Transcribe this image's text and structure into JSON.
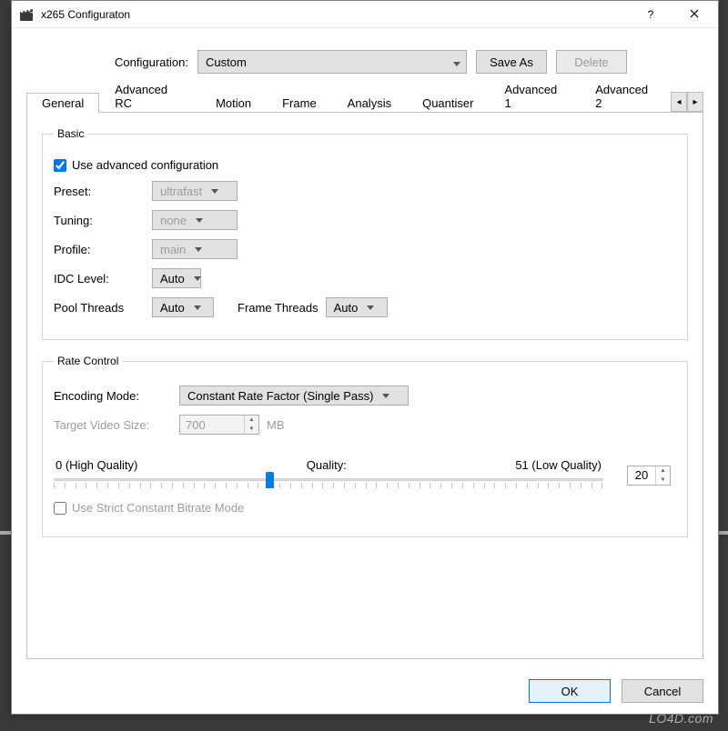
{
  "dialog": {
    "title": "x265 Configuraton"
  },
  "top": {
    "label": "Configuration:",
    "value": "Custom",
    "save_as": "Save As",
    "delete": "Delete"
  },
  "tabs": {
    "items": [
      {
        "label": "General",
        "active": true
      },
      {
        "label": "Advanced RC"
      },
      {
        "label": "Motion"
      },
      {
        "label": "Frame"
      },
      {
        "label": "Analysis"
      },
      {
        "label": "Quantiser"
      },
      {
        "label": "Advanced 1"
      },
      {
        "label": "Advanced 2"
      }
    ],
    "scroll_left": "◂",
    "scroll_right": "▸"
  },
  "basic": {
    "legend": "Basic",
    "use_advanced": {
      "label": "Use advanced configuration",
      "checked": true
    },
    "preset": {
      "label": "Preset:",
      "value": "ultrafast",
      "disabled": true
    },
    "tuning": {
      "label": "Tuning:",
      "value": "none",
      "disabled": true
    },
    "profile": {
      "label": "Profile:",
      "value": "main",
      "disabled": true
    },
    "idc": {
      "label": "IDC Level:",
      "value": "Auto"
    },
    "pool_threads": {
      "label": "Pool Threads",
      "value": "Auto"
    },
    "frame_threads": {
      "label": "Frame Threads",
      "value": "Auto"
    }
  },
  "rate": {
    "legend": "Rate Control",
    "encoding_mode": {
      "label": "Encoding Mode:",
      "value": "Constant Rate Factor (Single Pass)"
    },
    "target_size": {
      "label": "Target Video Size:",
      "value": "700",
      "unit": "MB",
      "disabled": true
    },
    "slider": {
      "min_label": "0 (High Quality)",
      "center_label": "Quality:",
      "max_label": "51 (Low Quality)",
      "min": 0,
      "max": 51,
      "value": 20
    },
    "quality_value": "20",
    "strict_cbr": {
      "label": "Use Strict Constant Bitrate Mode",
      "checked": false
    }
  },
  "footer": {
    "ok": "OK",
    "cancel": "Cancel"
  },
  "watermark": "LO4D.com"
}
